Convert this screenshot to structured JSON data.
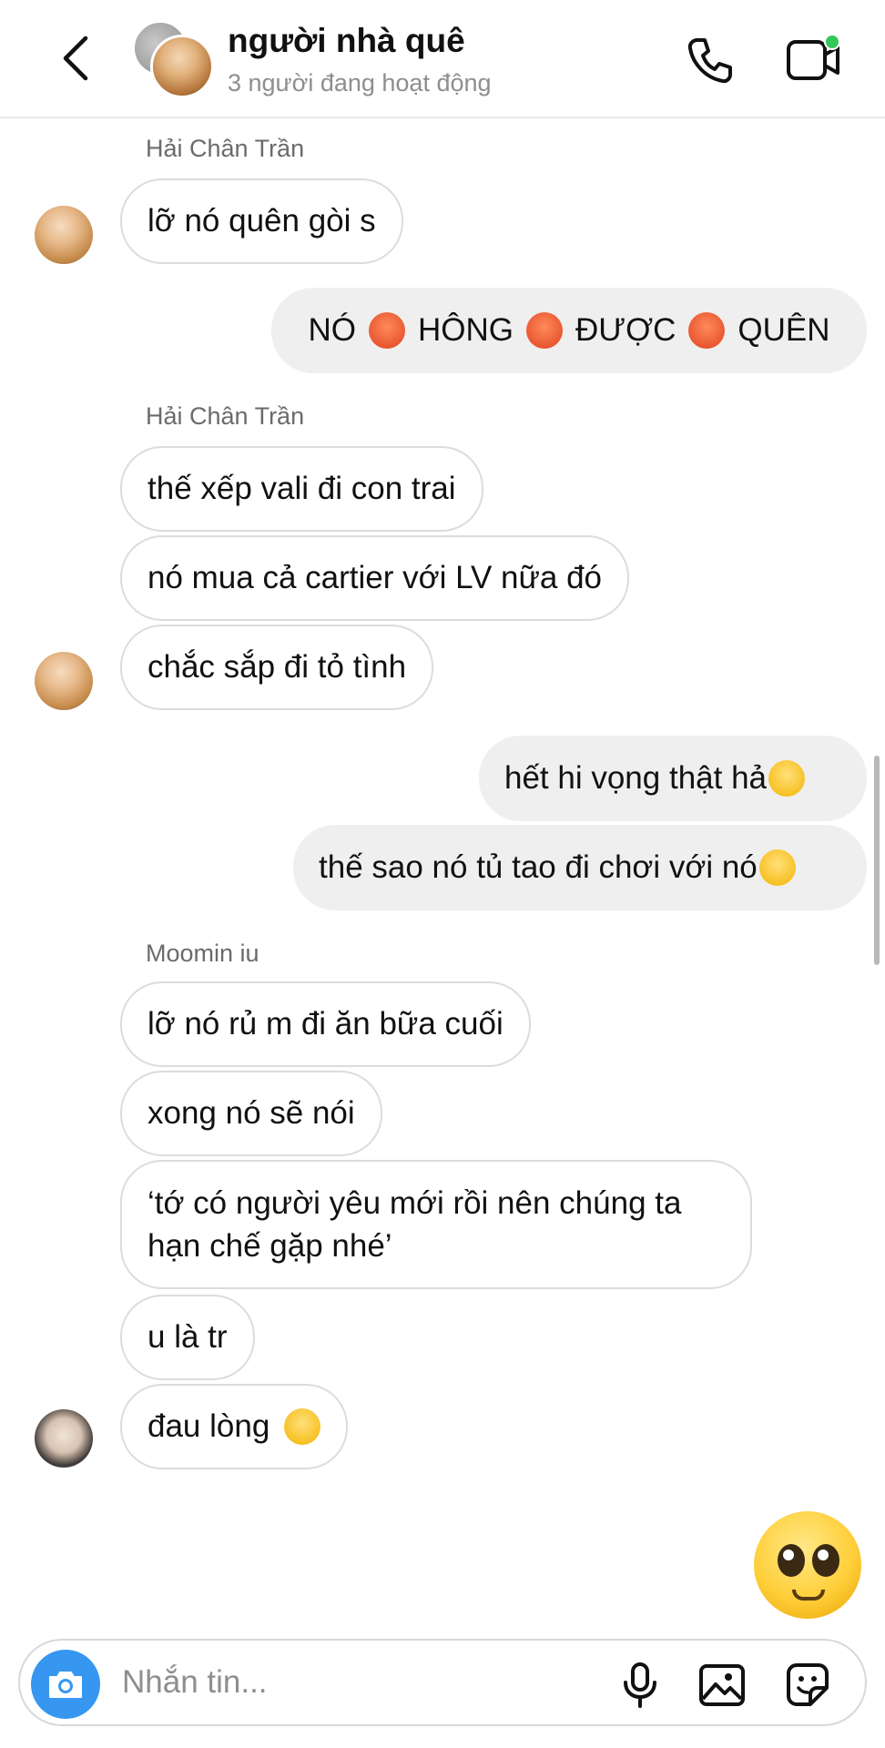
{
  "header": {
    "title": "người nhà quê",
    "subtitle": "3 người đang hoạt động"
  },
  "messages": [
    {
      "sender": "Hải Chân Trần",
      "direction": "in",
      "text": "lỡ nó quên gòi s"
    },
    {
      "direction": "out",
      "parts": [
        "NÓ",
        "HÔNG",
        "ĐƯỢC",
        "QUÊN"
      ],
      "emoji": "angry-face"
    },
    {
      "sender": "Hải Chân Trần",
      "direction": "in",
      "text": "thế xếp vali đi con trai"
    },
    {
      "direction": "in",
      "text": "nó mua cả cartier với LV nữa đó"
    },
    {
      "direction": "in",
      "text": "chắc sắp đi tỏ tình"
    },
    {
      "direction": "out",
      "text": "hết hi vọng thật hả",
      "emoji": "pensive-face"
    },
    {
      "direction": "out",
      "text": "thế sao nó tủ tao đi chơi với nó",
      "emoji": "disappointed-face"
    },
    {
      "sender": "Moomin iu",
      "direction": "in",
      "text": "lỡ nó rủ m đi ăn bữa cuối"
    },
    {
      "direction": "in",
      "text": "xong nó sẽ nói"
    },
    {
      "direction": "in",
      "lines": [
        "‘tớ có người yêu mới rồi nên chúng ta",
        "hạn chế gặp nhé’"
      ]
    },
    {
      "direction": "in",
      "text": "u là tr"
    },
    {
      "direction": "in",
      "text": "đau lòng",
      "emoji": "weary-face"
    }
  ],
  "reaction": {
    "emoji": "pleading-face"
  },
  "composer": {
    "placeholder": "Nhắn tin..."
  },
  "colors": {
    "accent": "#3797f0",
    "outgoing_bubble": "#efefef",
    "online_dot": "#34c759"
  }
}
